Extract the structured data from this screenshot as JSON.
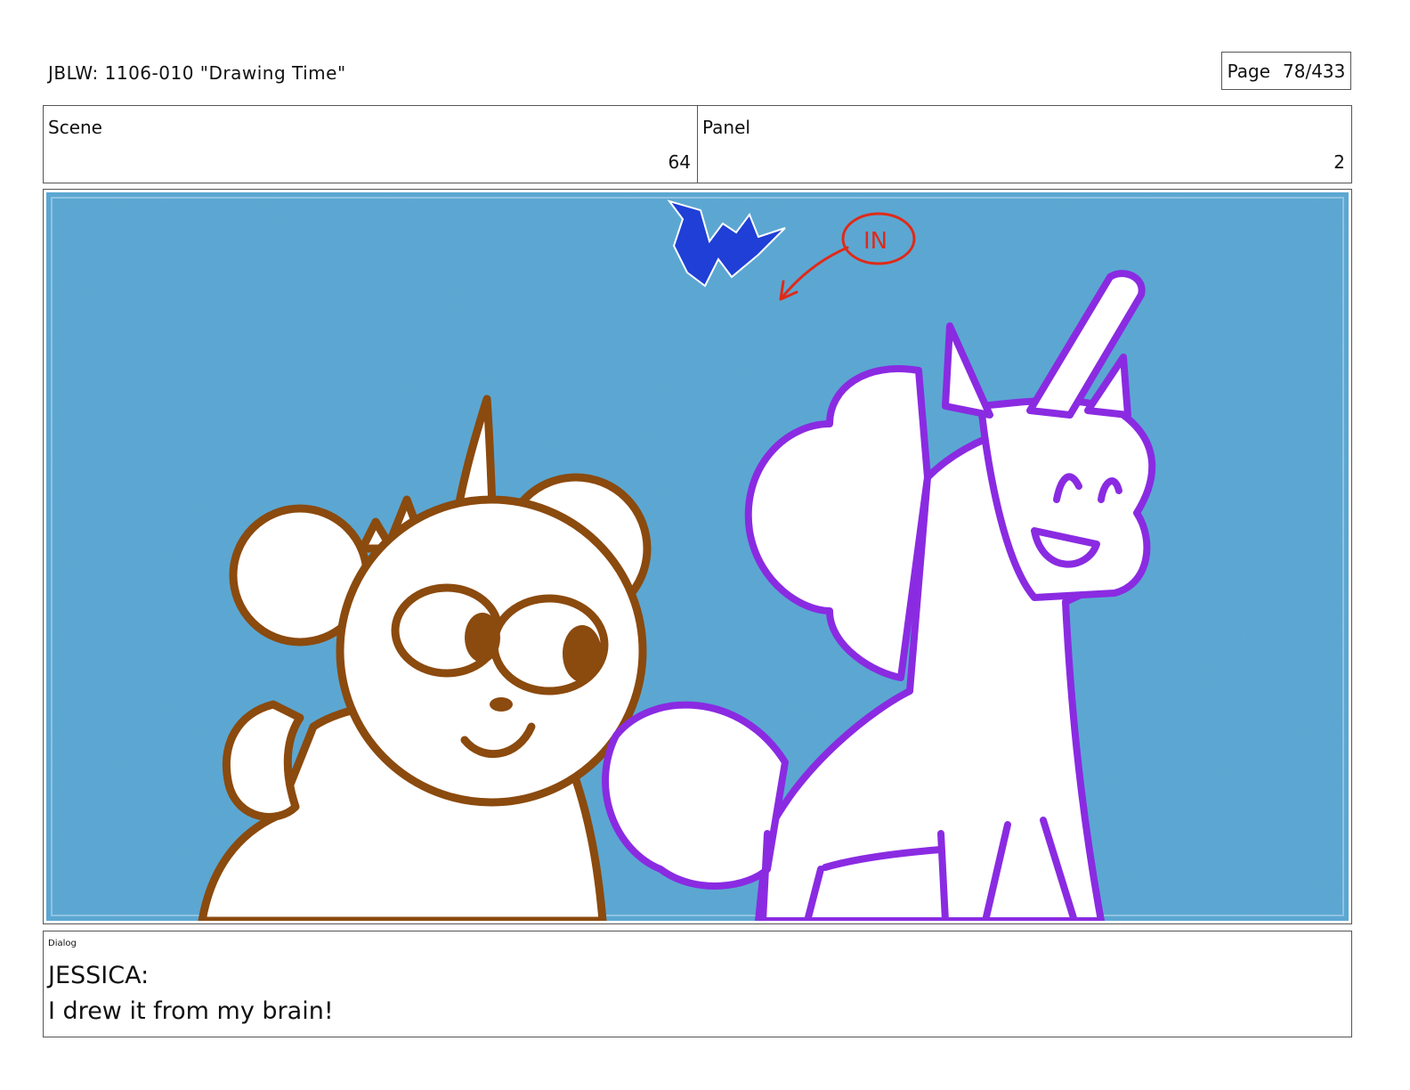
{
  "header": {
    "title": "JBLW: 1106-010 \"Drawing Time\"",
    "page_label": "Page",
    "page_number": "78/433"
  },
  "info": {
    "scene_label": "Scene",
    "scene_value": "64",
    "panel_label": "Panel",
    "panel_value": "2"
  },
  "panel": {
    "background_color": "#5ca8d4",
    "annotation_text": "IN",
    "colors": {
      "bear_outline": "#8b4a0e",
      "unicorn_outline": "#8a2be2",
      "annotation_red": "#e02a18",
      "blue_scribble": "#1f3fd6"
    }
  },
  "dialog": {
    "label": "Dialog",
    "speaker": "JESSICA:",
    "line": "I drew it from my brain!"
  }
}
